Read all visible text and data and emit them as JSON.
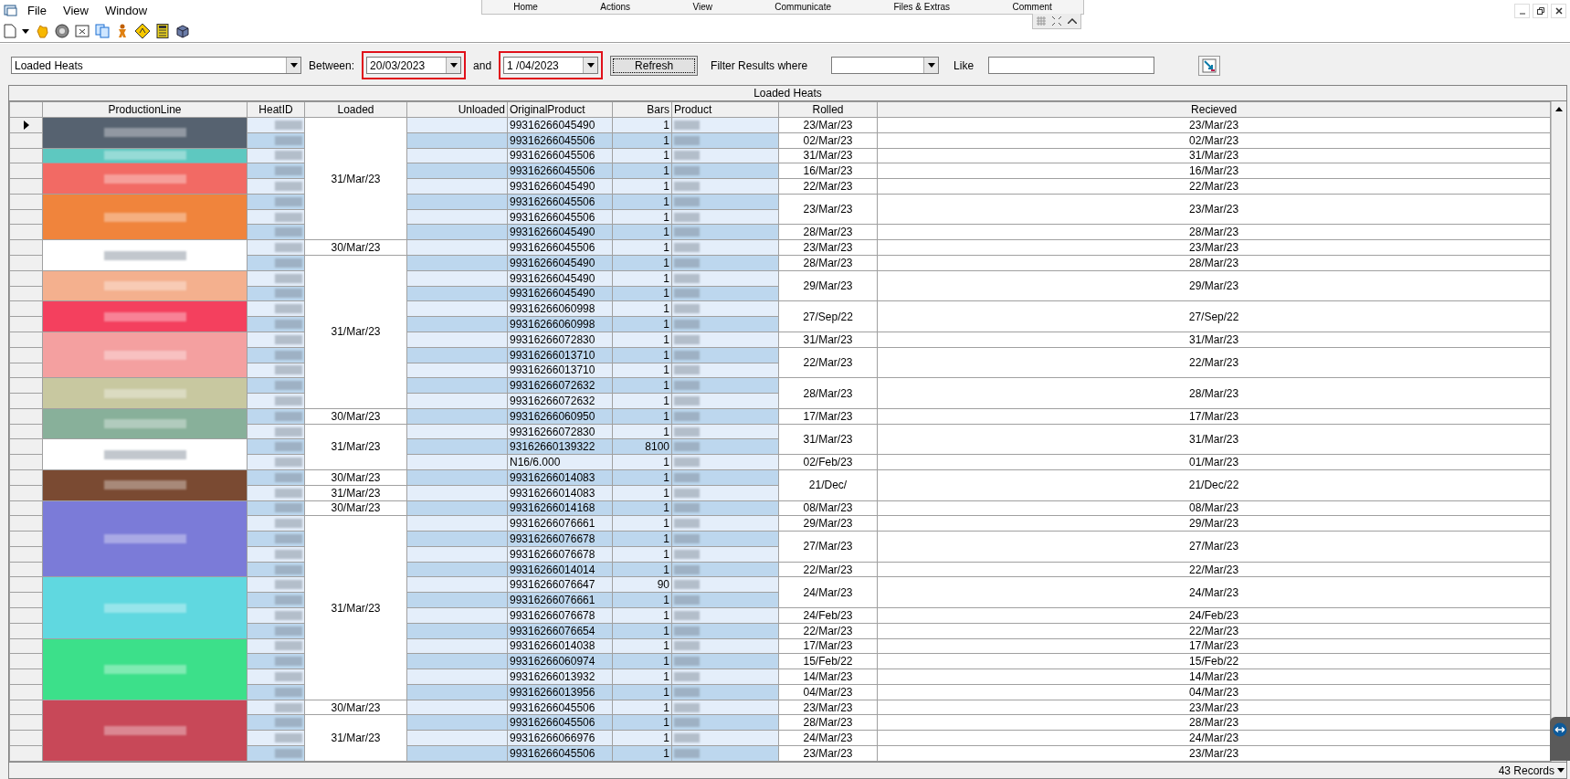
{
  "menu": [
    "File",
    "View",
    "Window"
  ],
  "remote_toolbar": {
    "items": [
      "Home",
      "Actions",
      "View",
      "Communicate",
      "Files & Extras",
      "Comment"
    ]
  },
  "filter": {
    "report": "Loaded Heats",
    "between_label": "Between:",
    "from": "20/03/2023",
    "and_label": "and",
    "to": "1 /04/2023",
    "refresh": "Refresh",
    "filter_label": "Filter Results where",
    "like_label": "Like"
  },
  "grid": {
    "title": "Loaded Heats",
    "columns": [
      "ProductionLine",
      "HeatID",
      "Loaded",
      "Unloaded",
      "OriginalProduct",
      "Bars",
      "Product",
      "Rolled",
      "Recieved"
    ],
    "rows": [
      {
        "selected": true,
        "color": "#566270",
        "loaded": "31/Mar/23",
        "original_product": "99316266045490",
        "bars": "1",
        "rolled": "23/Mar/23",
        "recieved": "23/Mar/23"
      },
      {
        "selected": false,
        "original_product": "99316266045506",
        "bars": "1",
        "rolled": "02/Mar/23",
        "recieved": "02/Mar/23"
      },
      {
        "selected": false,
        "color": "#5ec8c0",
        "original_product": "99316266045506",
        "bars": "1",
        "rolled": "31/Mar/23",
        "recieved": "31/Mar/23"
      },
      {
        "selected": false,
        "color": "#f26a64",
        "original_product": "99316266045506",
        "bars": "1",
        "rolled": "16/Mar/23",
        "recieved": "16/Mar/23"
      },
      {
        "selected": false,
        "original_product": "99316266045490",
        "bars": "1",
        "rolled": "22/Mar/23",
        "recieved": "22/Mar/23"
      },
      {
        "selected": false,
        "color": "#f0843c",
        "original_product": "99316266045506",
        "bars": "1",
        "rolled": "23/Mar/23",
        "recieved": "23/Mar/23"
      },
      {
        "selected": false,
        "original_product": "99316266045506",
        "bars": "1"
      },
      {
        "selected": false,
        "original_product": "99316266045490",
        "bars": "1",
        "rolled": "28/Mar/23",
        "recieved": "28/Mar/23"
      },
      {
        "selected": false,
        "color": "#ffffff",
        "loaded": "30/Mar/23",
        "original_product": "99316266045506",
        "bars": "1",
        "rolled": "23/Mar/23",
        "recieved": "23/Mar/23"
      },
      {
        "selected": false,
        "loaded": "31/Mar/23",
        "original_product": "99316266045490",
        "bars": "1",
        "rolled": "28/Mar/23",
        "recieved": "28/Mar/23"
      },
      {
        "selected": false,
        "color": "#f4b08e",
        "original_product": "99316266045490",
        "bars": "1",
        "rolled": "29/Mar/23",
        "recieved": "29/Mar/23"
      },
      {
        "selected": false,
        "original_product": "99316266045490",
        "bars": "1"
      },
      {
        "selected": false,
        "color": "#f4405e",
        "original_product": "99316266060998",
        "bars": "1",
        "rolled": "27/Sep/22",
        "recieved": "27/Sep/22"
      },
      {
        "selected": false,
        "original_product": "99316266060998",
        "bars": "1"
      },
      {
        "selected": false,
        "color": "#f4a0a0",
        "original_product": "99316266072830",
        "bars": "1",
        "rolled": "31/Mar/23",
        "recieved": "31/Mar/23"
      },
      {
        "selected": false,
        "original_product": "99316266013710",
        "bars": "1",
        "rolled": "22/Mar/23",
        "recieved": "22/Mar/23"
      },
      {
        "selected": false,
        "original_product": "99316266013710",
        "bars": "1"
      },
      {
        "selected": false,
        "color": "#c8c8a0",
        "original_product": "99316266072632",
        "bars": "1",
        "rolled": "28/Mar/23",
        "recieved": "28/Mar/23"
      },
      {
        "selected": false,
        "original_product": "99316266072632",
        "bars": "1"
      },
      {
        "selected": false,
        "color": "#88b09a",
        "loaded": "30/Mar/23",
        "original_product": "99316266060950",
        "bars": "1",
        "rolled": "17/Mar/23",
        "recieved": "17/Mar/23"
      },
      {
        "selected": false,
        "loaded": "31/Mar/23",
        "original_product": "99316266072830",
        "bars": "1",
        "rolled": "31/Mar/23",
        "recieved": "31/Mar/23"
      },
      {
        "selected": false,
        "color": "#ffffff",
        "original_product": "93162660139322",
        "bars": "8100"
      },
      {
        "selected": false,
        "original_product": "N16/6.000",
        "bars": "1",
        "rolled": "02/Feb/23",
        "recieved": "01/Mar/23"
      },
      {
        "selected": false,
        "color": "#7a4a32",
        "loaded": "30/Mar/23",
        "original_product": "99316266014083",
        "bars": "1",
        "rolled": "21/Dec/",
        "recieved": "21/Dec/22"
      },
      {
        "selected": false,
        "loaded": "31/Mar/23",
        "original_product": "99316266014083",
        "bars": "1"
      },
      {
        "selected": false,
        "color": "#7b7bd8",
        "loaded": "30/Mar/23",
        "original_product": "99316266014168",
        "bars": "1",
        "rolled": "08/Mar/23",
        "recieved": "08/Mar/23"
      },
      {
        "selected": false,
        "loaded": "31/Mar/23",
        "original_product": "99316266076661",
        "bars": "1",
        "rolled": "29/Mar/23",
        "recieved": "29/Mar/23"
      },
      {
        "selected": false,
        "original_product": "99316266076678",
        "bars": "1",
        "rolled": "27/Mar/23",
        "recieved": "27/Mar/23"
      },
      {
        "selected": false,
        "original_product": "99316266076678",
        "bars": "1"
      },
      {
        "selected": false,
        "original_product": "99316266014014",
        "bars": "1",
        "rolled": "22/Mar/23",
        "recieved": "22/Mar/23"
      },
      {
        "selected": false,
        "color": "#60d8e0",
        "original_product": "99316266076647",
        "bars": "90",
        "rolled": "24/Mar/23",
        "recieved": "24/Mar/23"
      },
      {
        "selected": false,
        "original_product": "99316266076661",
        "bars": "1"
      },
      {
        "selected": false,
        "original_product": "99316266076678",
        "bars": "1",
        "rolled": "24/Feb/23",
        "recieved": "24/Feb/23"
      },
      {
        "selected": false,
        "original_product": "99316266076654",
        "bars": "1",
        "rolled": "22/Mar/23",
        "recieved": "22/Mar/23"
      },
      {
        "selected": false,
        "color": "#3ce08a",
        "original_product": "99316266014038",
        "bars": "1",
        "rolled": "17/Mar/23",
        "recieved": "17/Mar/23"
      },
      {
        "selected": false,
        "original_product": "99316266060974",
        "bars": "1",
        "rolled": "15/Feb/22",
        "recieved": "15/Feb/22"
      },
      {
        "selected": false,
        "original_product": "99316266013932",
        "bars": "1",
        "rolled": "14/Mar/23",
        "recieved": "14/Mar/23"
      },
      {
        "selected": false,
        "original_product": "99316266013956",
        "bars": "1",
        "rolled": "04/Mar/23",
        "recieved": "04/Mar/23"
      },
      {
        "selected": false,
        "color": "#c84858",
        "loaded": "30/Mar/23",
        "original_product": "99316266045506",
        "bars": "1",
        "rolled": "23/Mar/23",
        "recieved": "23/Mar/23"
      },
      {
        "selected": false,
        "loaded": "31/Mar/23",
        "original_product": "99316266045506",
        "bars": "1",
        "rolled": "28/Mar/23",
        "recieved": "28/Mar/23"
      },
      {
        "selected": false,
        "original_product": "99316266066976",
        "bars": "1",
        "rolled": "24/Mar/23",
        "recieved": "24/Mar/23"
      },
      {
        "selected": false,
        "original_product": "99316266045506",
        "bars": "1",
        "rolled": "23/Mar/23",
        "recieved": "23/Mar/23"
      }
    ],
    "record_count": "43 Records"
  }
}
